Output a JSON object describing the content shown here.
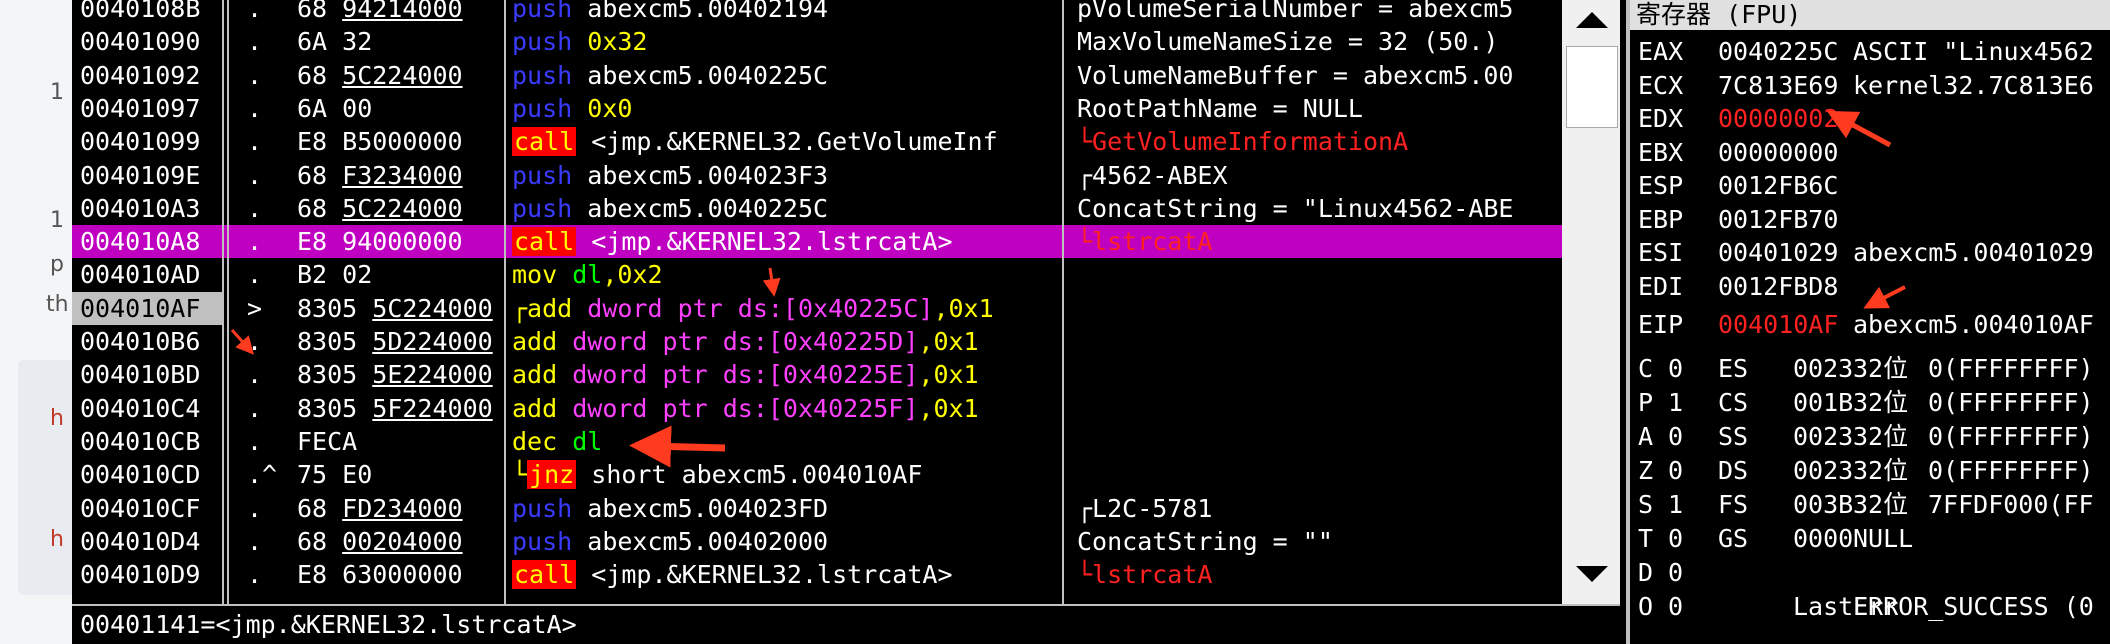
{
  "left_fragments": [
    {
      "text": "1"
    },
    {
      "text": "1"
    },
    {
      "text": "p"
    },
    {
      "text": "th"
    },
    {
      "text": "h"
    },
    {
      "text": "h"
    }
  ],
  "rows": [
    {
      "addr": "0040108B",
      "mark": ".",
      "hex": "68 94214000",
      "hex_pre": "68 ",
      "hex_ul": "94214000",
      "dis": [
        {
          "t": "push",
          "c": "kw-push"
        },
        {
          "t": " abexcm5.00402194",
          "c": ""
        }
      ],
      "cmt": "pVolumeSerialNumber = abexcm5"
    },
    {
      "addr": "00401090",
      "mark": ".",
      "hex_pre": "6A 32",
      "hex_ul": "",
      "dis": [
        {
          "t": "push",
          "c": "kw-push"
        },
        {
          "t": " 0x32",
          "c": "kw-yellow"
        }
      ],
      "cmt": "MaxVolumeNameSize = 32 (50.)"
    },
    {
      "addr": "00401092",
      "mark": ".",
      "hex_pre": "68 ",
      "hex_ul": "5C224000",
      "dis": [
        {
          "t": "push",
          "c": "kw-push"
        },
        {
          "t": " abexcm5.0040225C",
          "c": ""
        }
      ],
      "cmt": "VolumeNameBuffer = abexcm5.00"
    },
    {
      "addr": "00401097",
      "mark": ".",
      "hex_pre": "6A 00",
      "hex_ul": "",
      "dis": [
        {
          "t": "push",
          "c": "kw-push"
        },
        {
          "t": " 0x0",
          "c": "kw-yellow"
        }
      ],
      "cmt": "RootPathName = NULL"
    },
    {
      "addr": "00401099",
      "mark": ".",
      "hex_pre": "E8 B5000000",
      "hex_ul": "",
      "dis": [
        {
          "t": "call",
          "c": "kw-call"
        },
        {
          "t": " <jmp.&KERNEL32.GetVolumeInf",
          "c": ""
        }
      ],
      "cmt": "└GetVolumeInformationA",
      "cmt_red": true
    },
    {
      "addr": "0040109E",
      "mark": ".",
      "hex_pre": "68 ",
      "hex_ul": "F3234000",
      "dis": [
        {
          "t": "push",
          "c": "kw-push"
        },
        {
          "t": " abexcm5.004023F3",
          "c": ""
        }
      ],
      "cmt": "┌4562-ABEX"
    },
    {
      "addr": "004010A3",
      "mark": ".",
      "hex_pre": "68 ",
      "hex_ul": "5C224000",
      "dis": [
        {
          "t": "push",
          "c": "kw-push"
        },
        {
          "t": " abexcm5.0040225C",
          "c": ""
        }
      ],
      "cmt": "ConcatString = \"Linux4562-ABE"
    },
    {
      "addr": "004010A8",
      "mark": ".",
      "hex_pre": "E8 94000000",
      "hex_ul": "",
      "dis": [
        {
          "t": "call",
          "c": "kw-call"
        },
        {
          "t": " <jmp.&KERNEL32.lstrcatA>",
          "c": ""
        }
      ],
      "cmt": "└lstrcatA",
      "cmt_red": true,
      "hl": true
    },
    {
      "addr": "004010AD",
      "mark": ".",
      "hex_pre": "B2 02",
      "hex_ul": "",
      "dis": [
        {
          "t": "mov ",
          "c": "kw-yellow"
        },
        {
          "t": "dl",
          "c": "kw-green"
        },
        {
          "t": ",0x2",
          "c": "kw-yellow"
        }
      ],
      "cmt": ""
    },
    {
      "addr": "004010AF",
      "mark": ">",
      "hex_pre": "8305 ",
      "hex_ul": "5C224000",
      "dis": [
        {
          "t": "┌add ",
          "c": "kw-yellow"
        },
        {
          "t": "dword ptr ds:[0x40225C]",
          "c": "kw-magenta"
        },
        {
          "t": ",0x1",
          "c": "kw-yellow"
        }
      ],
      "cmt": "",
      "sel": true
    },
    {
      "addr": "004010B6",
      "mark": ".",
      "hex_pre": "8305 ",
      "hex_ul": "5D224000",
      "dis": [
        {
          "t": " add ",
          "c": "kw-yellow"
        },
        {
          "t": "dword ptr ds:[0x40225D]",
          "c": "kw-magenta"
        },
        {
          "t": ",0x1",
          "c": "kw-yellow"
        }
      ],
      "cmt": ""
    },
    {
      "addr": "004010BD",
      "mark": ".",
      "hex_pre": "8305 ",
      "hex_ul": "5E224000",
      "dis": [
        {
          "t": " add ",
          "c": "kw-yellow"
        },
        {
          "t": "dword ptr ds:[0x40225E]",
          "c": "kw-magenta"
        },
        {
          "t": ",0x1",
          "c": "kw-yellow"
        }
      ],
      "cmt": ""
    },
    {
      "addr": "004010C4",
      "mark": ".",
      "hex_pre": "8305 ",
      "hex_ul": "5F224000",
      "dis": [
        {
          "t": " add ",
          "c": "kw-yellow"
        },
        {
          "t": "dword ptr ds:[0x40225F]",
          "c": "kw-magenta"
        },
        {
          "t": ",0x1",
          "c": "kw-yellow"
        }
      ],
      "cmt": ""
    },
    {
      "addr": "004010CB",
      "mark": ".",
      "hex_pre": "FECA",
      "hex_ul": "",
      "dis": [
        {
          "t": " dec ",
          "c": "kw-yellow"
        },
        {
          "t": "dl",
          "c": "kw-green"
        }
      ],
      "cmt": ""
    },
    {
      "addr": "004010CD",
      "mark": ".^",
      "hex_pre": "75 E0",
      "hex_ul": "",
      "dis": [
        {
          "t": "└",
          "c": "kw-yellow"
        },
        {
          "t": "jnz",
          "c": "kw-jnz"
        },
        {
          "t": " short abexcm5.004010AF",
          "c": ""
        }
      ],
      "cmt": ""
    },
    {
      "addr": "004010CF",
      "mark": ".",
      "hex_pre": "68 ",
      "hex_ul": "FD234000",
      "dis": [
        {
          "t": "push",
          "c": "kw-push"
        },
        {
          "t": " abexcm5.004023FD",
          "c": ""
        }
      ],
      "cmt": "┌L2C-5781"
    },
    {
      "addr": "004010D4",
      "mark": ".",
      "hex_pre": "68 ",
      "hex_ul": "00204000",
      "dis": [
        {
          "t": "push",
          "c": "kw-push"
        },
        {
          "t": " abexcm5.00402000",
          "c": ""
        }
      ],
      "cmt": "ConcatString = \"\""
    },
    {
      "addr": "004010D9",
      "mark": ".",
      "hex_pre": "E8 63000000",
      "hex_ul": "",
      "dis": [
        {
          "t": "call",
          "c": "kw-call"
        },
        {
          "t": " <jmp.&KERNEL32.lstrcatA>",
          "c": ""
        }
      ],
      "cmt": "└lstrcatA",
      "cmt_red": true
    }
  ],
  "status": "00401141=<jmp.&KERNEL32.lstrcatA>",
  "registers": {
    "title": "寄存器 (FPU)",
    "list": [
      {
        "name": "EAX",
        "value": "0040225C",
        "desc": "ASCII \"Linux4562"
      },
      {
        "name": "ECX",
        "value": "7C813E69",
        "desc": "kernel32.7C813E6"
      },
      {
        "name": "EDX",
        "value": "00000002",
        "desc": "",
        "red": true
      },
      {
        "name": "EBX",
        "value": "00000000",
        "desc": ""
      },
      {
        "name": "ESP",
        "value": "0012FB6C",
        "desc": ""
      },
      {
        "name": "EBP",
        "value": "0012FB70",
        "desc": ""
      },
      {
        "name": "ESI",
        "value": "00401029",
        "desc": "abexcm5.00401029"
      },
      {
        "name": "EDI",
        "value": "0012FBD8",
        "desc": ""
      },
      {
        "name": "EIP",
        "value": "004010AF",
        "desc": "abexcm5.004010AF",
        "red": true
      }
    ],
    "flags": [
      {
        "f": "C",
        "v": "0",
        "seg": "ES",
        "sv": "0023",
        "bits": "32位",
        "d": "0(FFFFFFFF)"
      },
      {
        "f": "P",
        "v": "1",
        "seg": "CS",
        "sv": "001B",
        "bits": "32位",
        "d": "0(FFFFFFFF)"
      },
      {
        "f": "A",
        "v": "0",
        "seg": "SS",
        "sv": "0023",
        "bits": "32位",
        "d": "0(FFFFFFFF)"
      },
      {
        "f": "Z",
        "v": "0",
        "seg": "DS",
        "sv": "0023",
        "bits": "32位",
        "d": "0(FFFFFFFF)"
      },
      {
        "f": "S",
        "v": "1",
        "seg": "FS",
        "sv": "003B",
        "bits": "32位",
        "d": "7FFDF000(FF"
      },
      {
        "f": "T",
        "v": "0",
        "seg": "GS",
        "sv": "0000",
        "bits": "",
        "d": "NULL"
      },
      {
        "f": "D",
        "v": "0",
        "seg": "",
        "sv": "",
        "bits": "",
        "d": ""
      },
      {
        "f": "O",
        "v": "0",
        "seg": "",
        "sv": "LastErr",
        "bits": "",
        "d": "ERROR_SUCCESS (0"
      }
    ]
  },
  "colors": {
    "highlight": "#c000c0",
    "push": "#3b3bff",
    "call_bg": "#ff0000",
    "annotation": "#ff3b1f"
  }
}
